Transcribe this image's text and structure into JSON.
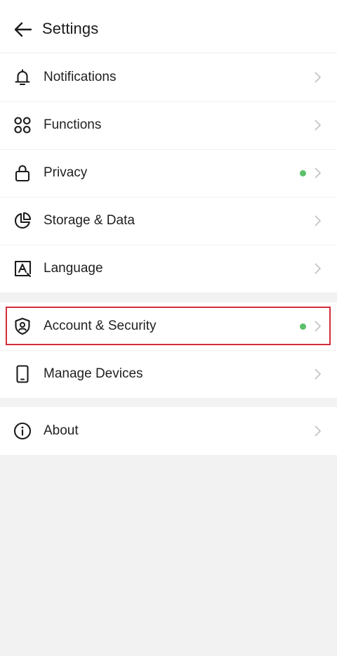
{
  "header": {
    "title": "Settings",
    "back_icon": "arrow-left-icon"
  },
  "colors": {
    "background": "#f2f2f2",
    "surface": "#ffffff",
    "text": "#1b1b1b",
    "chevron": "#c4c4c4",
    "status_dot": "#5cbf6a",
    "highlight": "#d32d3a"
  },
  "groups": [
    {
      "items": [
        {
          "label": "Notifications",
          "icon": "bell-icon",
          "status_dot": false
        },
        {
          "label": "Functions",
          "icon": "grid-icon",
          "status_dot": false
        },
        {
          "label": "Privacy",
          "icon": "lock-icon",
          "status_dot": true
        },
        {
          "label": "Storage & Data",
          "icon": "pie-chart-icon",
          "status_dot": false
        },
        {
          "label": "Language",
          "icon": "language-icon",
          "status_dot": false
        }
      ]
    },
    {
      "items": [
        {
          "label": "Account & Security",
          "icon": "shield-user-icon",
          "status_dot": true,
          "highlighted": true
        },
        {
          "label": "Manage Devices",
          "icon": "phone-icon",
          "status_dot": false
        }
      ]
    },
    {
      "items": [
        {
          "label": "About",
          "icon": "info-icon",
          "status_dot": false
        }
      ]
    }
  ]
}
